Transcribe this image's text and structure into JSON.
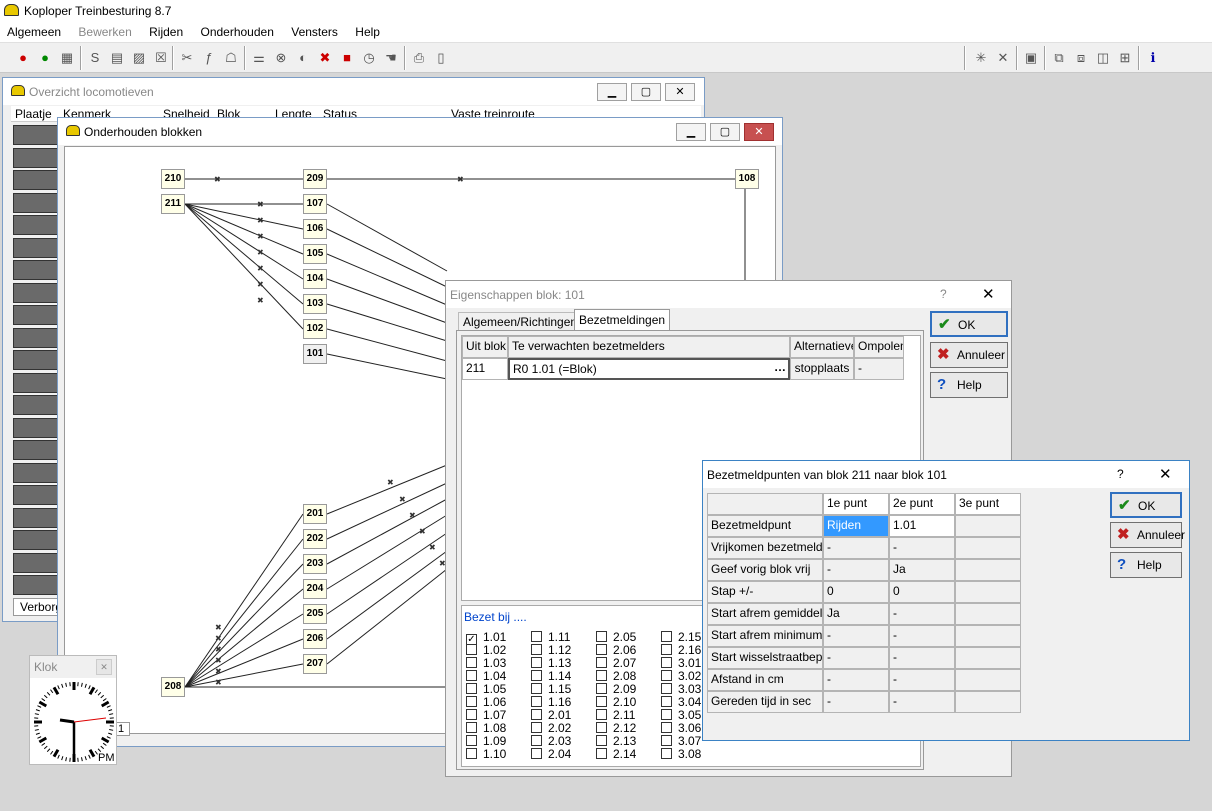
{
  "app": {
    "title": "Koploper Treinbesturing 8.7"
  },
  "menu": [
    "Algemeen",
    "Bewerken",
    "Rijden",
    "Onderhouden",
    "Vensters",
    "Help"
  ],
  "locoWindow": {
    "title": "Overzicht locomotieven",
    "columns": [
      "Plaatje",
      "Kenmerk",
      "Snelheid",
      "Blok",
      "Lengte",
      "Status",
      "Vaste treinroute"
    ],
    "tab": "Verborg"
  },
  "blocksWindow": {
    "title": "Onderhouden blokken",
    "sheet": "1"
  },
  "blockLabels": {
    "b210": "210",
    "b211": "211",
    "b209": "209",
    "b107": "107",
    "b106": "106",
    "b105": "105",
    "b104": "104",
    "b103": "103",
    "b102": "102",
    "b101": "101",
    "b108": "108",
    "b201": "201",
    "b202": "202",
    "b203": "203",
    "b204": "204",
    "b205": "205",
    "b206": "206",
    "b207": "207",
    "b208": "208"
  },
  "propsDialog": {
    "title": "Eigenschappen blok: 101",
    "tabs": [
      "Algemeen/Richtingen",
      "Bezetmeldingen"
    ],
    "table": {
      "headers": [
        "Uit blok",
        "Te verwachten bezetmelders",
        "Alternatieve",
        "Ompolen"
      ],
      "row": {
        "from": "211",
        "value": "R0  1.01 (=Blok)",
        "alt": "stopplaats",
        "ompolen": "-"
      }
    },
    "bezetLabel": "Bezet bij ....",
    "checkboxes": [
      [
        "1.01",
        "1.02",
        "1.03",
        "1.04",
        "1.05",
        "1.06",
        "1.07",
        "1.08",
        "1.09",
        "1.10"
      ],
      [
        "1.11",
        "1.12",
        "1.13",
        "1.14",
        "1.15",
        "1.16",
        "2.01",
        "2.02",
        "2.03",
        "2.04"
      ],
      [
        "2.05",
        "2.06",
        "2.07",
        "2.08",
        "2.09",
        "2.10",
        "2.11",
        "2.12",
        "2.13",
        "2.14"
      ],
      [
        "2.15",
        "2.16",
        "3.01",
        "3.02",
        "3.03",
        "3.04",
        "3.05",
        "3.06",
        "3.07",
        "3.08"
      ]
    ],
    "checked": "1.01",
    "buttons": {
      "ok": "OK",
      "cancel": "Annuleer",
      "help": "Help"
    }
  },
  "pointsDialog": {
    "title": "Bezetmeldpunten van blok 211 naar blok 101",
    "columns": [
      "1e punt",
      "2e punt",
      "3e punt"
    ],
    "rows": [
      {
        "label": "Bezetmeldpunt",
        "v1": "Rijden",
        "v2": "1.01",
        "v3": ""
      },
      {
        "label": "Vrijkomen bezetmelder",
        "v1": "-",
        "v2": "-",
        "v3": ""
      },
      {
        "label": "Geef vorig blok vrij",
        "v1": "-",
        "v2": "Ja",
        "v3": ""
      },
      {
        "label": "Stap +/-",
        "v1": "0",
        "v2": "0",
        "v3": ""
      },
      {
        "label": "Start afrem gemiddelde",
        "v1": "Ja",
        "v2": "-",
        "v3": ""
      },
      {
        "label": "Start afrem minimum",
        "v1": "-",
        "v2": "-",
        "v3": ""
      },
      {
        "label": "Start wisselstraatbep.",
        "v1": "-",
        "v2": "-",
        "v3": ""
      },
      {
        "label": "Afstand in cm",
        "v1": "-",
        "v2": "-",
        "v3": ""
      },
      {
        "label": "Gereden tijd in sec",
        "v1": "-",
        "v2": "-",
        "v3": ""
      }
    ],
    "buttons": {
      "ok": "OK",
      "cancel": "Annuleer",
      "help": "Help"
    }
  },
  "clock": {
    "title": "Klok",
    "ampm": "PM"
  }
}
